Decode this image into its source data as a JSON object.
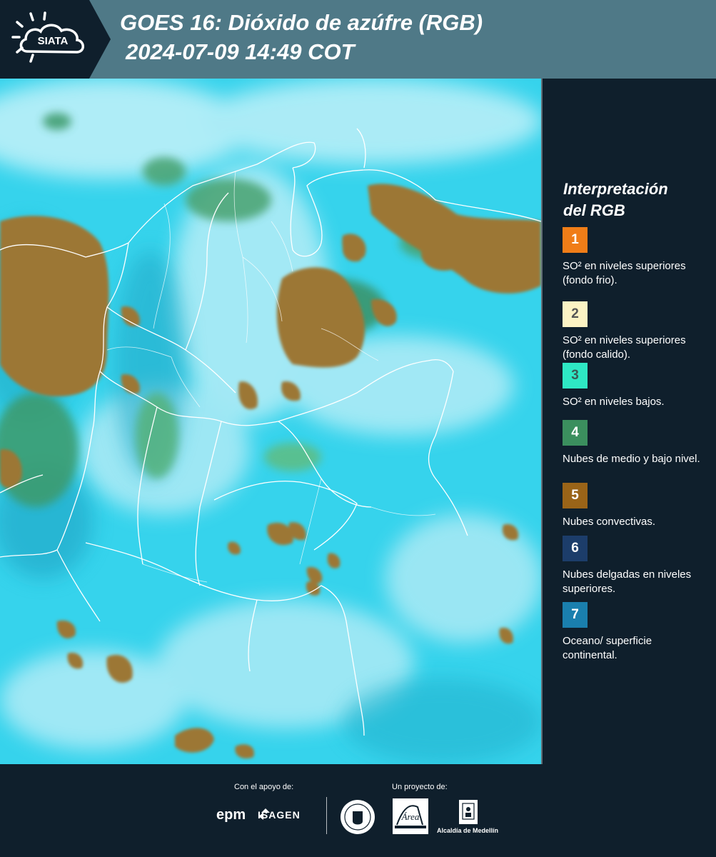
{
  "header": {
    "logo_text": "SIATA",
    "title_line1": "GOES 16: Dióxido de azúfre (RGB)",
    "title_line2": "2024-07-09 14:49 COT"
  },
  "legend": {
    "title_line1": "Interpretación",
    "title_line2": "del RGB",
    "items": [
      {
        "number": "1",
        "color": "#f07d18",
        "number_color": "#ffffff",
        "text": "SO² en niveles superiores (fondo frio)."
      },
      {
        "number": "2",
        "color": "#fcf3c4",
        "number_color": "#555555",
        "text": "SO² en niveles superiores (fondo calido)."
      },
      {
        "number": "3",
        "color": "#2ee8c4",
        "number_color": "#3a5a55",
        "text": "SO² en niveles bajos."
      },
      {
        "number": "4",
        "color": "#3b8f5e",
        "number_color": "#ffffff",
        "text": "Nubes de medio y bajo nivel."
      },
      {
        "number": "5",
        "color": "#9a6418",
        "number_color": "#ffffff",
        "text": "Nubes convectivas."
      },
      {
        "number": "6",
        "color": "#1c3d6a",
        "number_color": "#ffffff",
        "text": "Nubes delgadas en niveles superiores."
      },
      {
        "number": "7",
        "color": "#1a7fae",
        "number_color": "#ffffff",
        "text": "Oceano/ superficie continental."
      }
    ]
  },
  "footer": {
    "support_label": "Con el apoyo de:",
    "project_label": "Un proyecto de:",
    "sponsor_1": "epm",
    "sponsor_2": "ISAGEN",
    "partner_1": "Área Metropolitana Valle de Aburrá",
    "partner_2": "Alcaldía de Medellín"
  },
  "map": {
    "ocean_land_color": "#36d3ec",
    "convective_cloud_color": "#9c7734",
    "low_cloud_color": "#3e9a6a",
    "boundary_color": "#ffffff"
  }
}
